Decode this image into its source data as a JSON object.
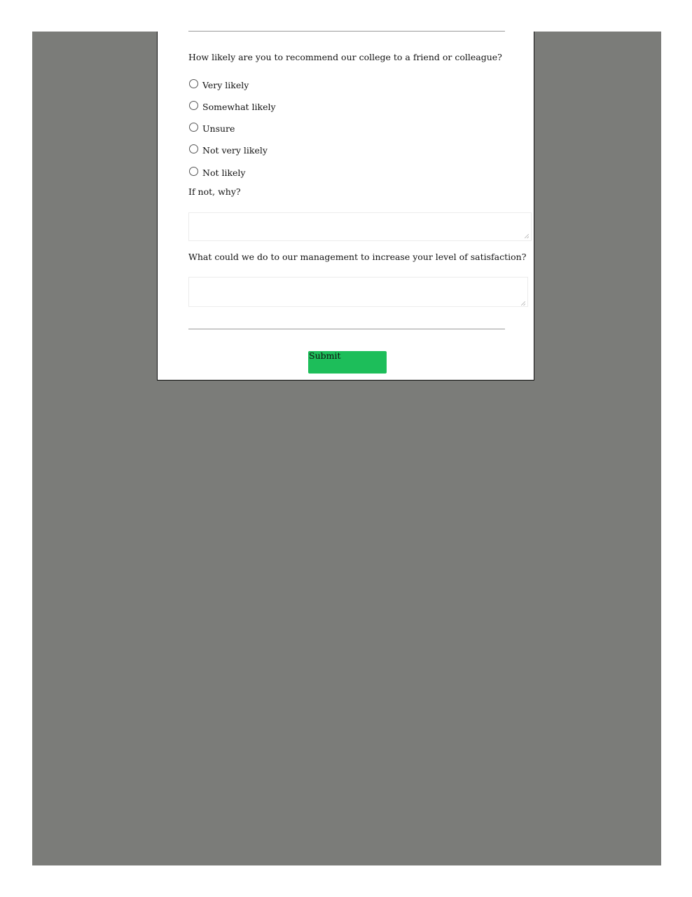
{
  "survey": {
    "question_recommend": "How likely are you to recommend our college to a friend or colleague?",
    "options": [
      {
        "label": "Very likely",
        "selected": false
      },
      {
        "label": "Somewhat likely",
        "selected": false
      },
      {
        "label": "Unsure",
        "selected": false
      },
      {
        "label": "Not very likely",
        "selected": false
      },
      {
        "label": "Not likely",
        "selected": false
      }
    ],
    "question_why_not": "If not, why?",
    "why_not_value": "",
    "question_management": "What could we do to our management to increase your level of satisfaction?",
    "management_value": "",
    "submit_label": "Submit"
  },
  "colors": {
    "backdrop": "#7b7c79",
    "card": "#ffffff",
    "submit_button": "#1dbe5a"
  }
}
